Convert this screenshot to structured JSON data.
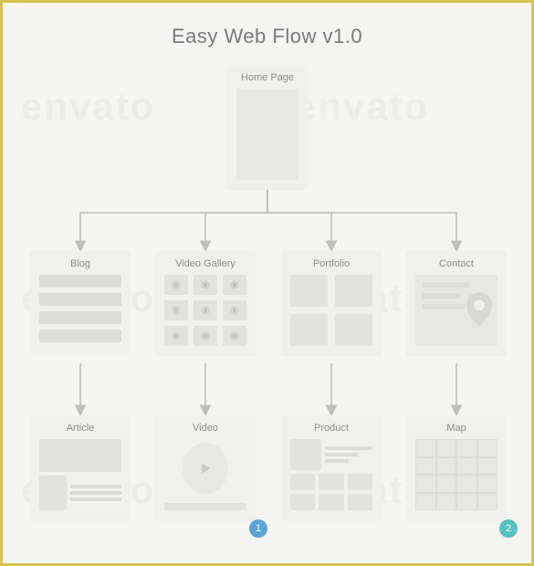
{
  "title": "Easy Web Flow v1.0",
  "nodes": {
    "home": {
      "label": "Home Page"
    },
    "blog": {
      "label": "Blog"
    },
    "gallery": {
      "label": "Video Gallery"
    },
    "portfolio": {
      "label": "Portfolio"
    },
    "contact": {
      "label": "Contact"
    },
    "article": {
      "label": "Article"
    },
    "video": {
      "label": "Video"
    },
    "product": {
      "label": "Product"
    },
    "map": {
      "label": "Map"
    }
  },
  "badges": {
    "b1": "1",
    "b2": "2"
  },
  "watermark": "envato"
}
